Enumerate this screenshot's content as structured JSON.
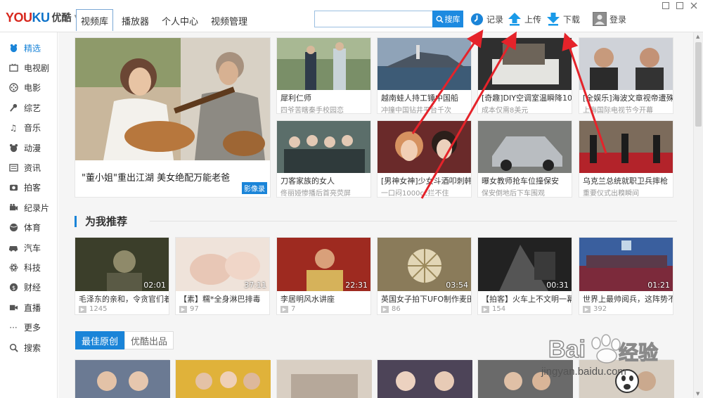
{
  "app": {
    "logo_latin_1": "YOU",
    "logo_latin_2": "KU",
    "logo_cn": "优酷",
    "window_controls": [
      "□",
      "□",
      "✕"
    ]
  },
  "nav": [
    "视频库",
    "播放器",
    "个人中心",
    "视频管理"
  ],
  "search": {
    "value": "",
    "button": "搜库"
  },
  "tools": {
    "history": "记录",
    "upload": "上传",
    "download": "下载",
    "login": "登录"
  },
  "sidebar": [
    {
      "label": "精选",
      "icon": "featured-icon"
    },
    {
      "label": "电视剧",
      "icon": "tv-icon"
    },
    {
      "label": "电影",
      "icon": "film-reel-icon"
    },
    {
      "label": "综艺",
      "icon": "microphone-icon"
    },
    {
      "label": "音乐",
      "icon": "music-note-icon"
    },
    {
      "label": "动漫",
      "icon": "bear-icon"
    },
    {
      "label": "资讯",
      "icon": "news-icon"
    },
    {
      "label": "拍客",
      "icon": "camera-icon"
    },
    {
      "label": "纪录片",
      "icon": "camcorder-icon"
    },
    {
      "label": "体育",
      "icon": "ball-icon"
    },
    {
      "label": "汽车",
      "icon": "car-icon"
    },
    {
      "label": "科技",
      "icon": "atom-icon"
    },
    {
      "label": "财经",
      "icon": "dollar-icon"
    },
    {
      "label": "直播",
      "icon": "live-icon"
    },
    {
      "label": "更多",
      "icon": "more-dots-icon"
    },
    {
      "label": "搜索",
      "icon": "search-icon"
    }
  ],
  "featured": {
    "title": "\"董小姐\"重出江湖 美女绝配万能老爸",
    "badge": "影像录"
  },
  "top_grid": [
    {
      "t1": "犀利仁师",
      "t2": "四爷苦瞎秦手校园恋"
    },
    {
      "t1": "越南蛙人持工锤中国船",
      "t2": "冲撞中国钻井平台千次"
    },
    {
      "t1": "[奇趣]DIY空调室温瞬降10度",
      "t2": "成本仅需8美元"
    },
    {
      "t1": "[全娱乐]海波文章视帝遭殊名",
      "t2": "上海国际电视节今开幕"
    },
    {
      "t1": "刀客家族的女人",
      "t2": "佟丽娅惨播后首亮荧屏"
    },
    {
      "t1": "[男神女神]少女斗酒叩刺韩星",
      "t2": "一口闷1000cc拦不住"
    },
    {
      "t1": "曝女教师抢车位撞保安",
      "t2": "保安倒地后下车围观"
    },
    {
      "t1": "乌克兰总统就职卫兵摔枪",
      "t2": "重要仪式出糗瞬间"
    }
  ],
  "recommend": {
    "title": "为我推荐",
    "items": [
      {
        "title": "毛泽东的亲和，令贪官们着后",
        "views": "1245",
        "dur": "02:01"
      },
      {
        "title": "【素】糯*全身淋巴排毒",
        "views": "97",
        "dur": "37:11"
      },
      {
        "title": "李居明风水讲座",
        "views": "7",
        "dur": "22:31"
      },
      {
        "title": "英国女子拍下UFO制作麦田",
        "views": "86",
        "dur": "03:54"
      },
      {
        "title": "【拍客】火车上不文明一幕",
        "views": "154",
        "dur": "00:31"
      },
      {
        "title": "世界上最帅阅兵，这阵势不",
        "views": "392",
        "dur": "01:21"
      }
    ]
  },
  "tabs2": [
    "最佳原创",
    "优酷出品"
  ],
  "watermark": {
    "line1": "Bai",
    "line2": "经验",
    "url": "jingyan.baidu.com"
  },
  "colors": {
    "accent": "#1a84d8",
    "logo_red": "#d8281e",
    "arrow_red": "#e5232a"
  }
}
